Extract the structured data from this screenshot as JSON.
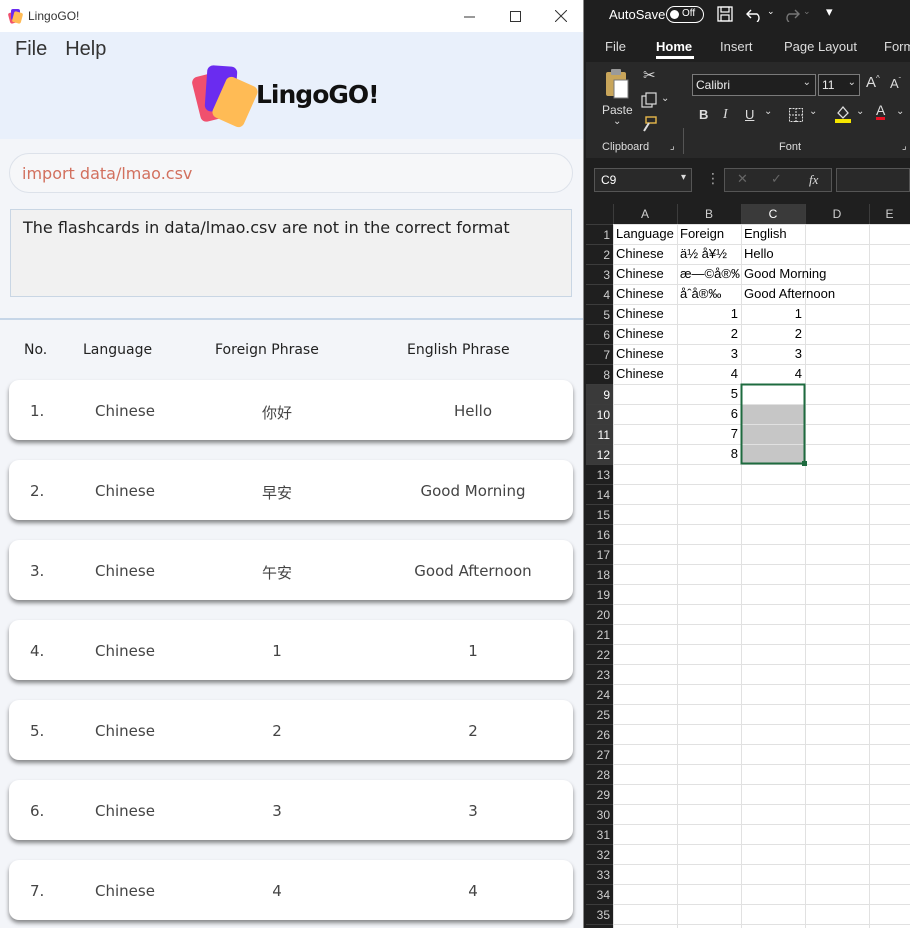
{
  "lingo": {
    "window_title": "LingoGO!",
    "menu": [
      "File",
      "Help"
    ],
    "logo_text": "LingoGO!",
    "command_input": "import data/lmao.csv",
    "result_message": "The flashcards in data/lmao.csv are not in the correct format",
    "columns": [
      "No.",
      "Language",
      "Foreign Phrase",
      "English Phrase"
    ],
    "flashcards": [
      {
        "no": "1.",
        "language": "Chinese",
        "foreign": "你好",
        "english": "Hello"
      },
      {
        "no": "2.",
        "language": "Chinese",
        "foreign": "早安",
        "english": "Good Morning"
      },
      {
        "no": "3.",
        "language": "Chinese",
        "foreign": "午安",
        "english": "Good Afternoon"
      },
      {
        "no": "4.",
        "language": "Chinese",
        "foreign": "1",
        "english": "1"
      },
      {
        "no": "5.",
        "language": "Chinese",
        "foreign": "2",
        "english": "2"
      },
      {
        "no": "6.",
        "language": "Chinese",
        "foreign": "3",
        "english": "3"
      },
      {
        "no": "7.",
        "language": "Chinese",
        "foreign": "4",
        "english": "4"
      }
    ],
    "colors": {
      "header_bg": "#e9f0fb",
      "command_text": "#d2705e",
      "card_purple": "#6a2cf0",
      "card_red": "#f0506e",
      "card_orange": "#ffbb55"
    }
  },
  "excel": {
    "autosave_label": "AutoSave",
    "autosave_state": "Off",
    "tabs": [
      "File",
      "Home",
      "Insert",
      "Page Layout",
      "Form"
    ],
    "active_tab": "Home",
    "paste_label": "Paste",
    "font_name": "Calibri",
    "font_size": "11",
    "clipboard_group": "Clipboard",
    "font_group": "Font",
    "name_box": "C9",
    "fx_label": "fx",
    "col_headers": [
      "A",
      "B",
      "C",
      "D",
      "E"
    ],
    "row_count": 35,
    "rows": [
      [
        "Language",
        "Foreign",
        "English"
      ],
      [
        "Chinese",
        "ä½ å¥½",
        "Hello"
      ],
      [
        "Chinese",
        "æ—©å®‰",
        "Good Morning"
      ],
      [
        "Chinese",
        "åˆå®‰",
        "Good Afternoon"
      ],
      [
        "Chinese",
        "1",
        "1"
      ],
      [
        "Chinese",
        "2",
        "2"
      ],
      [
        "Chinese",
        "3",
        "3"
      ],
      [
        "Chinese",
        "4",
        "4"
      ],
      [
        "",
        "5",
        ""
      ],
      [
        "",
        "6",
        ""
      ],
      [
        "",
        "7",
        ""
      ],
      [
        "",
        "8",
        ""
      ]
    ],
    "selected_range": "C9:C12"
  }
}
